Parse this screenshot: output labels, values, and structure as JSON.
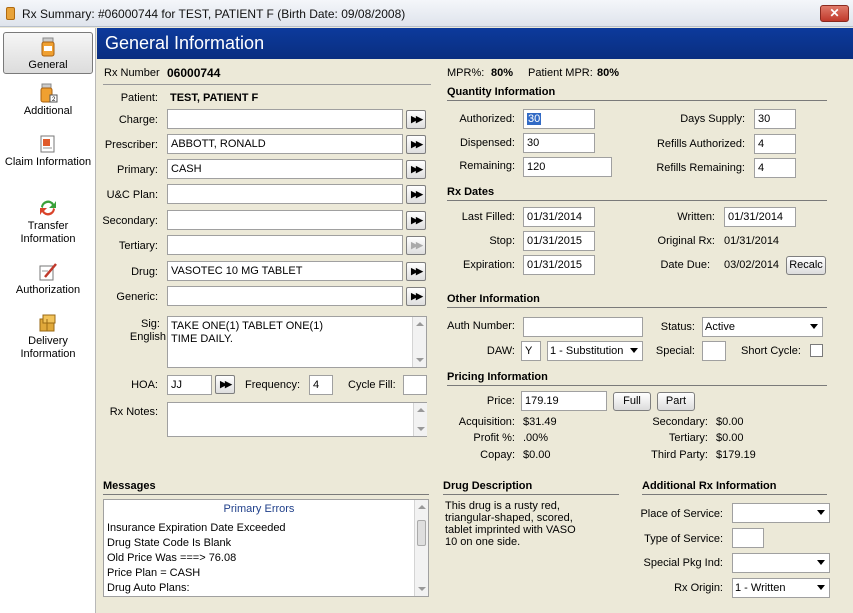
{
  "window": {
    "title": "Rx Summary: #06000744 for TEST, PATIENT F (Birth Date: 09/08/2008)",
    "close": "✕"
  },
  "sidebar": {
    "items": [
      {
        "label": "General",
        "icon": "pill-bottle-icon"
      },
      {
        "label": "Additional",
        "icon": "pill-bottle-2-icon"
      },
      {
        "label": "Claim Information",
        "icon": "claim-document-icon"
      },
      {
        "label": "Transfer Information",
        "icon": "transfer-arrows-icon"
      },
      {
        "label": "Authorization",
        "icon": "authorization-pen-icon"
      },
      {
        "label": "Delivery Information",
        "icon": "delivery-box-icon"
      }
    ]
  },
  "header": {
    "title": "General Information"
  },
  "rx": {
    "number_label": "Rx Number",
    "number": "06000744",
    "mpr_label": "MPR%:",
    "mpr": "80%",
    "patient_mpr_label": "Patient MPR:",
    "patient_mpr": "80%",
    "patient_label": "Patient:",
    "patient": "TEST, PATIENT F",
    "charge_label": "Charge:",
    "charge": "",
    "prescriber_label": "Prescriber:",
    "prescriber": "ABBOTT, RONALD",
    "primary_label": "Primary:",
    "primary": "CASH",
    "uc_plan_label": "U&C Plan:",
    "uc_plan": "",
    "secondary_label": "Secondary:",
    "secondary": "",
    "tertiary_label": "Tertiary:",
    "tertiary": "",
    "drug_label": "Drug:",
    "drug": "VASOTEC 10 MG TABLET",
    "generic_label": "Generic:",
    "generic": "",
    "sig_label": "Sig:",
    "sig_english_label": "English",
    "sig_line1": "TAKE ONE(1) TABLET ONE(1)",
    "sig_line2": "TIME DAILY.",
    "hoa_label": "HOA:",
    "hoa": "JJ",
    "frequency_label": "Frequency:",
    "frequency": "4",
    "cycle_fill_label": "Cycle Fill:",
    "cycle_fill": "",
    "notes_label": "Rx Notes:",
    "notes": ""
  },
  "quantity": {
    "title": "Quantity Information",
    "authorized_label": "Authorized:",
    "authorized": "30",
    "dispensed_label": "Dispensed:",
    "dispensed": "30",
    "remaining_label": "Remaining:",
    "remaining": "120",
    "days_supply_label": "Days Supply:",
    "days_supply": "30",
    "refills_authorized_label": "Refills Authorized:",
    "refills_authorized": "4",
    "refills_remaining_label": "Refills Remaining:",
    "refills_remaining": "4"
  },
  "dates": {
    "title": "Rx Dates",
    "last_filled_label": "Last Filled:",
    "last_filled": "01/31/2014",
    "stop_label": "Stop:",
    "stop": "01/31/2015",
    "expiration_label": "Expiration:",
    "expiration": "01/31/2015",
    "written_label": "Written:",
    "written": "01/31/2014",
    "original_label": "Original Rx:",
    "original": "01/31/2014",
    "due_label": "Date Due:",
    "due": "03/02/2014",
    "recalc": "Recalc"
  },
  "other": {
    "title": "Other Information",
    "auth_number_label": "Auth Number:",
    "auth_number": "",
    "status_label": "Status:",
    "status": "Active",
    "daw_label": "DAW:",
    "daw": "Y",
    "daw_option": "1 - Substitution",
    "special_label": "Special:",
    "special": "",
    "short_cycle_label": "Short Cycle:"
  },
  "pricing": {
    "title": "Pricing Information",
    "price_label": "Price:",
    "price": "179.19",
    "full": "Full",
    "part": "Part",
    "acquisition_label": "Acquisition:",
    "acquisition": "$31.49",
    "profit_label": "Profit %:",
    "profit": ".00%",
    "copay_label": "Copay:",
    "copay": "$0.00",
    "secondary_label": "Secondary:",
    "secondary": "$0.00",
    "tertiary_label": "Tertiary:",
    "tertiary": "$0.00",
    "third_party_label": "Third Party:",
    "third_party": "$179.19"
  },
  "messages": {
    "title": "Messages",
    "heading": "Primary Errors",
    "lines": [
      "Insurance Expiration Date Exceeded",
      "Drug State Code Is Blank",
      "Old Price Was ===> 76.08",
      "Price Plan = CASH",
      "Drug Auto Plans:"
    ]
  },
  "drug_description": {
    "title": "Drug Description",
    "lines": [
      "This drug is a rusty red,",
      "triangular-shaped, scored,",
      "tablet imprinted with VASO",
      "10 on one side."
    ]
  },
  "additional_rx": {
    "title": "Additional Rx Information",
    "place_label": "Place of Service:",
    "place": "",
    "type_label": "Type of Service:",
    "type": "",
    "pkg_label": "Special Pkg Ind:",
    "pkg": "",
    "origin_label": "Rx Origin:",
    "origin": "1 - Written"
  },
  "colors": {
    "header_bg": "#0c3a9c",
    "selected_text": "#316ac5"
  }
}
